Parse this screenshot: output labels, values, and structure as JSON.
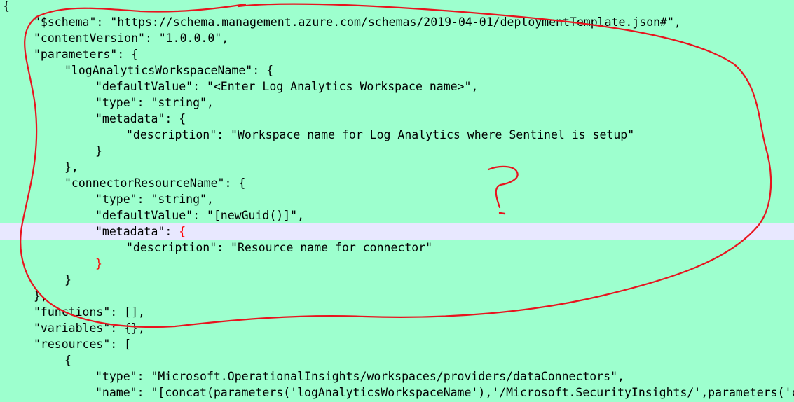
{
  "editor": {
    "colors": {
      "background": "#9dffce",
      "current_line": "#e8e8ff",
      "text": "#000000",
      "matched_brace": "#ff0000",
      "annotation": "#e8141e"
    },
    "current_line_index": 14,
    "lines": [
      {
        "indent": 0,
        "segments": [
          {
            "text": "{"
          }
        ]
      },
      {
        "indent": 1,
        "segments": [
          {
            "text": "\"$schema\": \""
          },
          {
            "text": "https://schema.management.azure.com/schemas/2019-04-01/deploymentTemplate.json#",
            "link": true
          },
          {
            "text": "\","
          }
        ]
      },
      {
        "indent": 1,
        "segments": [
          {
            "text": "\"contentVersion\": \"1.0.0.0\","
          }
        ]
      },
      {
        "indent": 1,
        "segments": [
          {
            "text": "\"parameters\": {"
          }
        ]
      },
      {
        "indent": 2,
        "segments": [
          {
            "text": "\"logAnalyticsWorkspaceName\": {"
          }
        ]
      },
      {
        "indent": 3,
        "segments": [
          {
            "text": "\"defaultValue\": \"<Enter Log Analytics Workspace name>\","
          }
        ]
      },
      {
        "indent": 3,
        "segments": [
          {
            "text": "\"type\": \"string\","
          }
        ]
      },
      {
        "indent": 3,
        "segments": [
          {
            "text": "\"metadata\": {"
          }
        ]
      },
      {
        "indent": 4,
        "segments": [
          {
            "text": "\"description\": \"Workspace name for Log Analytics where Sentinel is setup\""
          }
        ]
      },
      {
        "indent": 3,
        "segments": [
          {
            "text": "}"
          }
        ]
      },
      {
        "indent": 2,
        "segments": [
          {
            "text": "},"
          }
        ]
      },
      {
        "indent": 2,
        "segments": [
          {
            "text": "\"connectorResourceName\": {"
          }
        ]
      },
      {
        "indent": 3,
        "segments": [
          {
            "text": "\"type\": \"string\","
          }
        ]
      },
      {
        "indent": 3,
        "segments": [
          {
            "text": "\"defaultValue\": \"[newGuid()]\","
          }
        ]
      },
      {
        "indent": 3,
        "segments": [
          {
            "text": "\"metadata\": "
          },
          {
            "text": "{",
            "brace": true
          },
          {
            "caret": true
          }
        ]
      },
      {
        "indent": 4,
        "segments": [
          {
            "text": "\"description\": \"Resource name for connector\""
          }
        ]
      },
      {
        "indent": 3,
        "segments": [
          {
            "text": "}",
            "brace": true
          }
        ]
      },
      {
        "indent": 2,
        "segments": [
          {
            "text": "}"
          }
        ]
      },
      {
        "indent": 1,
        "segments": [
          {
            "text": "},"
          }
        ]
      },
      {
        "indent": 1,
        "segments": [
          {
            "text": "\"functions\": [],"
          }
        ]
      },
      {
        "indent": 1,
        "segments": [
          {
            "text": "\"variables\": {},"
          }
        ]
      },
      {
        "indent": 1,
        "segments": [
          {
            "text": "\"resources\": ["
          }
        ]
      },
      {
        "indent": 2,
        "segments": [
          {
            "text": "{"
          }
        ]
      },
      {
        "indent": 3,
        "segments": [
          {
            "text": "\"type\": \"Microsoft.OperationalInsights/workspaces/providers/dataConnectors\","
          }
        ]
      },
      {
        "indent": 3,
        "segments": [
          {
            "text": "\"name\": \"[concat(parameters('logAnalyticsWorkspaceName'),'/Microsoft.SecurityInsights/',parameters('connectorResourceName'))]\","
          }
        ]
      }
    ],
    "annotation": {
      "question_mark": "?"
    }
  }
}
